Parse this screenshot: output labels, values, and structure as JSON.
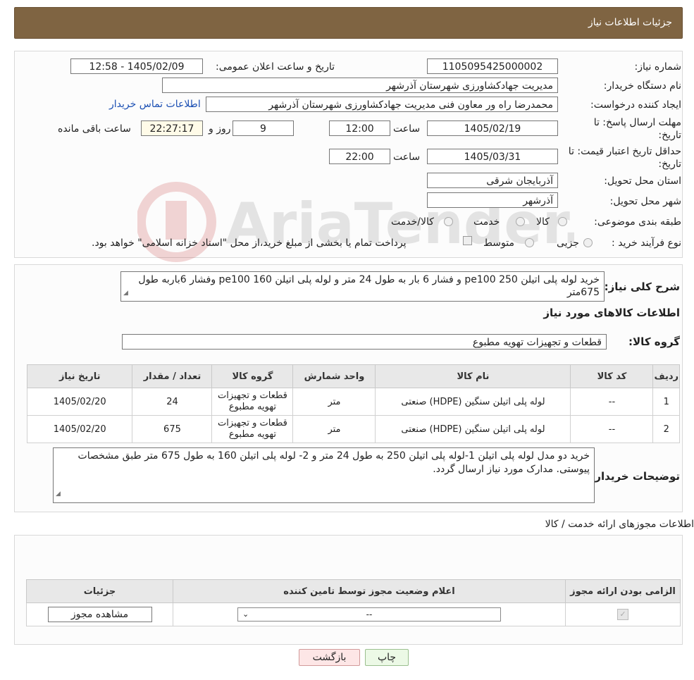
{
  "header": {
    "title": "جزئیات اطلاعات نیاز"
  },
  "form": {
    "need_number_label": "شماره نیاز:",
    "need_number": "1105095425000002",
    "announce_label": "تاریخ و ساعت اعلان عمومی:",
    "announce_value": "1405/02/09 - 12:58",
    "buyer_org_label": "نام دستگاه خریدار:",
    "buyer_org": "مدیریت جهادکشاورزی شهرستان آذرشهر",
    "creator_label": "ایجاد کننده درخواست:",
    "creator": "محمدرضا راه ور معاون فنی مدیریت جهادکشاورزی شهرستان آذرشهر",
    "contact_link": "اطلاعات تماس خریدار",
    "deadline_label_1": "مهلت ارسال پاسخ: تا",
    "deadline_label_2": "تاریخ:",
    "deadline_date": "1405/02/19",
    "time_label": "ساعت",
    "deadline_time": "12:00",
    "days_value": "9",
    "days_label": "روز و",
    "remaining_time": "22:27:17",
    "remaining_label": "ساعت باقی مانده",
    "validity_label_1": "حداقل تاریخ اعتبار قیمت: تا",
    "validity_label_2": "تاریخ:",
    "validity_date": "1405/03/31",
    "validity_time": "22:00",
    "province_label": "استان محل تحویل:",
    "province": "آذربایجان شرقی",
    "city_label": "شهر محل تحویل:",
    "city": "آذرشهر",
    "category_label": "طبقه بندی موضوعی:",
    "category_options": [
      "کالا",
      "خدمت",
      "کالا/خدمت"
    ],
    "process_label": "نوع فرآیند خرید :",
    "process_options": [
      "جزیی",
      "متوسط"
    ],
    "process_note": "پرداخت تمام یا بخشی از مبلغ خرید،از محل \"اسناد خزانه اسلامی\" خواهد بود."
  },
  "summary": {
    "label": "شرح کلی نیاز:",
    "text": "خرید لوله پلی اتیلن pe100 250  و فشار 6 بار به طول 24 متر و لوله پلی اتیلن pe100 160 وفشار 6باربه طول 675متر",
    "goods_title": "اطلاعات کالاهای مورد نیاز",
    "group_label": "گروه کالا:",
    "group_value": "قطعات و تجهیزات تهویه مطبوع"
  },
  "goods_table": {
    "headers": [
      "ردیف",
      "کد کالا",
      "نام کالا",
      "واحد شمارش",
      "گروه کالا",
      "تعداد / مقدار",
      "تاریخ نیاز"
    ],
    "rows": [
      [
        "1",
        "--",
        "لوله پلی اتیلن سنگین (HDPE) صنعتی",
        "متر",
        "قطعات و تجهیزات تهویه مطبوع",
        "24",
        "1405/02/20"
      ],
      [
        "2",
        "--",
        "لوله پلی اتیلن سنگین (HDPE) صنعتی",
        "متر",
        "قطعات و تجهیزات تهویه مطبوع",
        "675",
        "1405/02/20"
      ]
    ]
  },
  "buyer_notes": {
    "label": "توضیحات خریدار:",
    "text": "خرید دو مدل لوله پلی اتیلن 1-لوله پلی اتیلن 250 به طول 24 متر و 2- لوله پلی اتیلن 160 به طول 675 متر طبق مشخصات پیوستی. مدارک مورد نیاز ارسال گردد."
  },
  "license": {
    "title": "اطلاعات مجوزهای ارائه خدمت / کالا",
    "headers": [
      "الزامی بودن ارائه مجوز",
      "اعلام وضعیت مجوز توسط تامین کننده",
      "جزئیات"
    ],
    "select_value": "--",
    "view_button": "مشاهده مجوز"
  },
  "buttons": {
    "print": "چاپ",
    "back": "بازگشت"
  },
  "watermark_text": "AriaTender.neT"
}
